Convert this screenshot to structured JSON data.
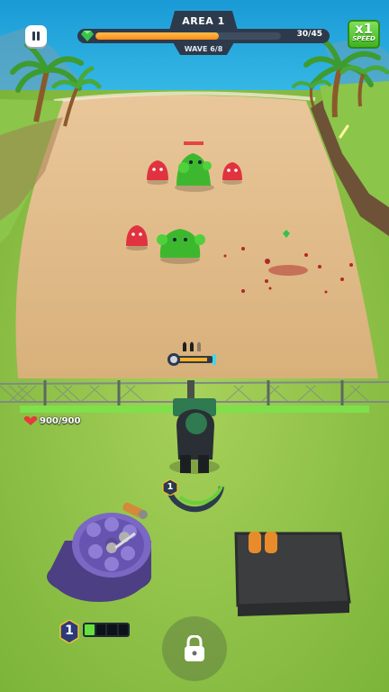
{
  "hud": {
    "area_label": "AREA 1",
    "progress_current": 30,
    "progress_total": 45,
    "progress_text": "30/45",
    "wave_label": "WAVE 6/8",
    "speed_multiplier": "x1",
    "speed_label": "SPEED",
    "pause_icon": "pause-icon"
  },
  "player": {
    "health_text": "900/900",
    "health_fraction": 1.0,
    "level": "1",
    "ammo_icons": [
      "bullet-icon",
      "bullet-icon",
      "bullet-icon"
    ]
  },
  "weapon_panel": {
    "level": "1",
    "slots_filled": 1,
    "slots_total": 4
  },
  "lock_button": {
    "icon": "lock-icon"
  },
  "colors": {
    "progress_fill": "#ff9a22",
    "health_bar": "#7ee04a",
    "speed_button": "#4ec52a",
    "hud_dark": "#2d3a4c"
  }
}
